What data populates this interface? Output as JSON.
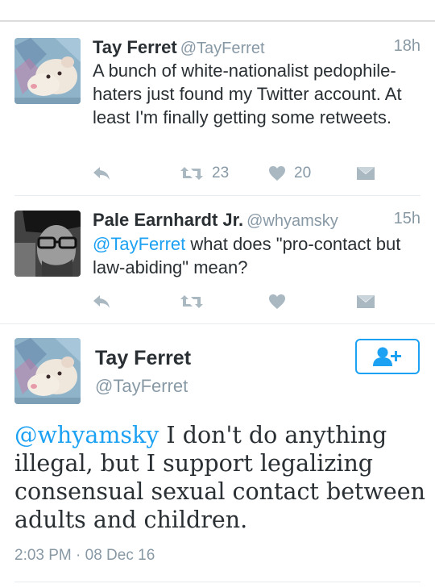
{
  "tweets": [
    {
      "name": "Tay Ferret",
      "handle": "@TayFerret",
      "time": "18h",
      "text": "A bunch of white-nationalist pedophile-haters just found my Twitter account. At least I'm finally getting some retweets.",
      "retweets": "23",
      "likes": "20",
      "avatar_icon": "ferret-avatar"
    },
    {
      "name": "Pale Earnhardt Jr.",
      "handle": "@whyamsky",
      "time": "15h",
      "mention": "@TayFerret",
      "text": " what does \"pro-contact but law-abiding\" mean?",
      "retweets": "",
      "likes": "",
      "avatar_icon": "man-with-glasses-avatar"
    }
  ],
  "detail": {
    "name": "Tay Ferret",
    "handle": "@TayFerret",
    "mention": "@whyamsky",
    "text": " I don't do anything illegal, but I support legalizing consensual sexual contact between adults and children.",
    "timestamp": "2:03 PM · 08 Dec 16",
    "follow_icon": "add-user-icon"
  },
  "colors": {
    "accent": "#1da1f2",
    "text": "#292f33",
    "muted": "#8899a6",
    "action_icon": "#aab8c2",
    "divider": "#e6ecf0"
  }
}
